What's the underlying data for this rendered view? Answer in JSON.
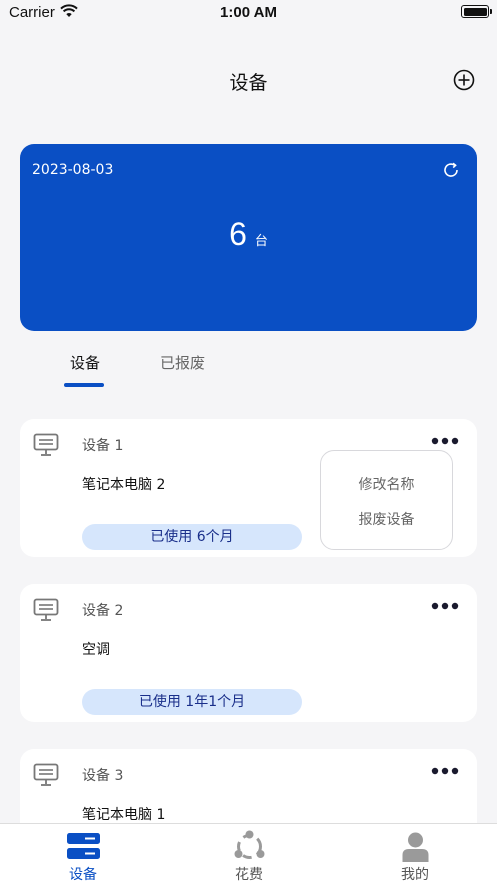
{
  "status_bar": {
    "carrier": "Carrier",
    "time": "1:00 AM"
  },
  "header": {
    "title": "设备",
    "add_icon": "plus-circle-icon"
  },
  "summary": {
    "date": "2023-08-03",
    "count": "6",
    "unit": "台",
    "refresh_icon": "refresh-icon"
  },
  "tabs": [
    {
      "label": "设备",
      "active": true
    },
    {
      "label": "已报废",
      "active": false
    }
  ],
  "devices": [
    {
      "label": "设备 1",
      "name": "笔记本电脑 2",
      "usage": "已使用 6个月"
    },
    {
      "label": "设备 2",
      "name": "空调",
      "usage": "已使用 1年1个月"
    },
    {
      "label": "设备 3",
      "name": "笔记本电脑 1",
      "usage": ""
    }
  ],
  "popup_menu": {
    "rename": "修改名称",
    "scrap": "报废设备"
  },
  "tab_bar": [
    {
      "label": "设备",
      "icon": "device-list-icon",
      "active": true
    },
    {
      "label": "花费",
      "icon": "share-icon",
      "active": false
    },
    {
      "label": "我的",
      "icon": "person-icon",
      "active": false
    }
  ],
  "colors": {
    "primary": "#0a4fc4",
    "badge_bg": "#d6e6fc",
    "inactive": "#9a9a9a"
  }
}
